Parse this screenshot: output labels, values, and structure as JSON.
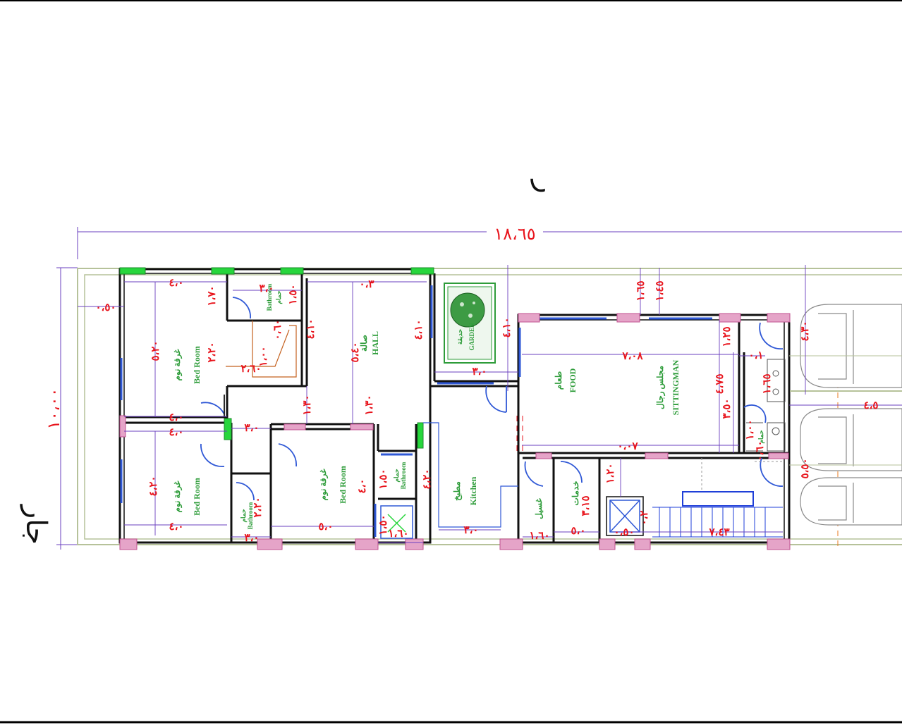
{
  "drawing": {
    "overall_width": "١٨،٦٥",
    "overall_depth": "١٠،٠٠",
    "street_top": "ر",
    "street_left": "جار",
    "colors": {
      "wall": "#111111",
      "dimension_text": "#e8141c",
      "room_label": "#2e9c3a",
      "dim_line": "#6a3fbf",
      "window": "#2f58d6",
      "boundary": "#b6c29a",
      "column": "#c0508f",
      "green_marker": "#27d63c",
      "stair": "#1f3fd8",
      "car": "#8a8a8a"
    }
  },
  "rooms": {
    "bed1_ar": "غرفة نوم",
    "bed1_en": "Bed Room",
    "bed2_ar": "غرفة نوم",
    "bed2_en": "Bed Room",
    "bed3_ar": "غرفة نوم",
    "bed3_en": "Bed Room",
    "hall_ar": "صالة",
    "hall_en": "HALL",
    "garden_ar": "حديقة",
    "garden_en": "GARDEN",
    "food_ar": "طعام",
    "food_en": "FOOD",
    "sitting_ar": "مجلس رجال",
    "sitting_en": "SITTINGMAN",
    "kitchen_ar": "مطبخ",
    "kitchen_en": "Kitchen",
    "bath1_ar": "حمام",
    "bath1_en": "Bathroom",
    "bath2_ar": "حمام",
    "bath2_en": "Bathroom",
    "bath3_ar": "حمام",
    "bath3_en": "Bathroom",
    "bath4_ar": "حمام",
    "laundry_ar": "غسيل",
    "services_ar": "خدمات"
  },
  "dims": {
    "d_050_a": "٠،٥٠",
    "d_040_a": "٤،٠",
    "d_520": "٥،٢٠",
    "d_400_a": "٤،٠",
    "d_170": "١،٧٠",
    "d_220_a": "٢،٢٠",
    "d_300_a": "٣،٠",
    "d_150_a": "١،٥٠",
    "d_060": "٠،٦٠",
    "d_100": "١،٠٠",
    "d_260": "٢،٦٠",
    "d_410_a": "٤،١٠",
    "d_030": "٠،٣",
    "d_540": "٥،٤٠",
    "d_410_b": "٤،١٠",
    "d_130_a": "١،٣٠",
    "d_130_b": "١،٣٠",
    "d_400_b": "٤،٠",
    "d_400_c": "٤،٠",
    "d_300_b": "٣،٠",
    "d_420_a": "٤،٢٠",
    "d_400_d": "٤،٠",
    "d_300_c": "٣،٠",
    "d_220_b": "٢،٢٠",
    "d_150_b": "١،٥٠",
    "d_500": "٥،٠",
    "d_400_e": "٤،٠",
    "d_150_c": "١،٥٠",
    "d_300_d": "٣،٠",
    "d_420_b": "٤،٢٠",
    "d_150_d": "١،٥٠",
    "d_160": "١،٦٠",
    "d_300_e": "٣،٠",
    "d_410_c": "٤،١٠",
    "d_030_b": "٠،٣",
    "d_165": "١،٦٥",
    "d_145": "١،٤٥",
    "d_708": "٧،٠٨",
    "d_007": "٠،٠٧",
    "d_120": "١،٢٠",
    "d_315": "٣،١٥",
    "d_050_b": "٠،٥٠",
    "d_160_b": "١،٦٠",
    "d_125": "١،٢٥",
    "d_475": "٤،٧٥",
    "d_350": "٣،٥٠",
    "d_010": "٠،١",
    "d_165_b": "١،٦٥",
    "d_100_b": "١،٠٠",
    "d_060_b": "٠،٦٠",
    "d_050_c": "٠،٥٠",
    "d_430": "٤،٣٠",
    "d_450": "٤،٥",
    "d_550": "٥،٥٠",
    "d_500_b": "٥،٠",
    "d_160_c": "١،٦٠",
    "d_743": "٧،٤٣",
    "d_020": "٠،٢"
  }
}
